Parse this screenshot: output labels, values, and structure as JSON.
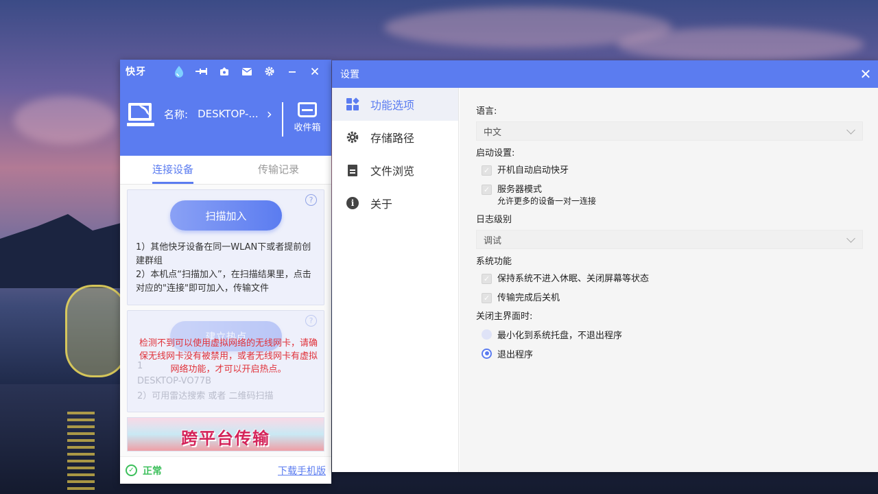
{
  "main_window": {
    "logo": "快牙",
    "titlebar_icons": [
      "gift-drop-icon",
      "pin-icon",
      "backup-icon",
      "mail-icon",
      "gear-icon",
      "minimize-icon",
      "close-icon"
    ],
    "device": {
      "name_label": "名称:",
      "name_value": "DESKTOP-...",
      "inbox_label": "收件箱"
    },
    "tabs": [
      {
        "label": "连接设备",
        "active": true
      },
      {
        "label": "传输记录",
        "active": false
      }
    ],
    "scan_card": {
      "button_label": "扫描加入",
      "help": "?",
      "text_line1": "1）其他快牙设备在同一WLAN下或者提前创建群组",
      "text_line2": "2）本机点“扫描加入”，在扫描结果里，点击对应的\"连接\"即可加入，传输文件"
    },
    "hotspot_card": {
      "button_label": "建立热点",
      "help": "?",
      "faded_line1": "1",
      "faded_line2": "DESKTOP-VO77B",
      "faded_line3": "2）可用雷达搜索 或者 二维码扫描",
      "warning": "检测不到可以使用虚拟网络的无线网卡，请确保无线网卡没有被禁用，或者无线网卡有虚拟网络功能，才可以开启热点。"
    },
    "banner": {
      "text": "跨平台传输"
    },
    "footer": {
      "status": "正常",
      "download_link": "下载手机版"
    }
  },
  "settings_window": {
    "title": "设置",
    "nav": [
      {
        "label": "功能选项",
        "icon": "grid-icon",
        "active": true
      },
      {
        "label": "存储路径",
        "icon": "gear-icon",
        "active": false
      },
      {
        "label": "文件浏览",
        "icon": "document-icon",
        "active": false
      },
      {
        "label": "关于",
        "icon": "info-icon",
        "active": false
      }
    ],
    "language": {
      "label": "语言:",
      "value": "中文"
    },
    "startup": {
      "label": "启动设置:",
      "auto_start": "开机自动启动快牙",
      "server_mode": "服务器模式",
      "server_mode_desc": "允许更多的设备一对一连接"
    },
    "log_level": {
      "label": "日志级别",
      "value": "调试"
    },
    "system": {
      "label": "系统功能",
      "keep_awake": "保持系统不进入休眠、关闭屏幕等状态",
      "shutdown_after": "传输完成后关机"
    },
    "close_main": {
      "label": "关闭主界面时:",
      "opt_minimize": "最小化到系统托盘，不退出程序",
      "opt_exit": "退出程序",
      "selected": "opt_exit"
    }
  }
}
